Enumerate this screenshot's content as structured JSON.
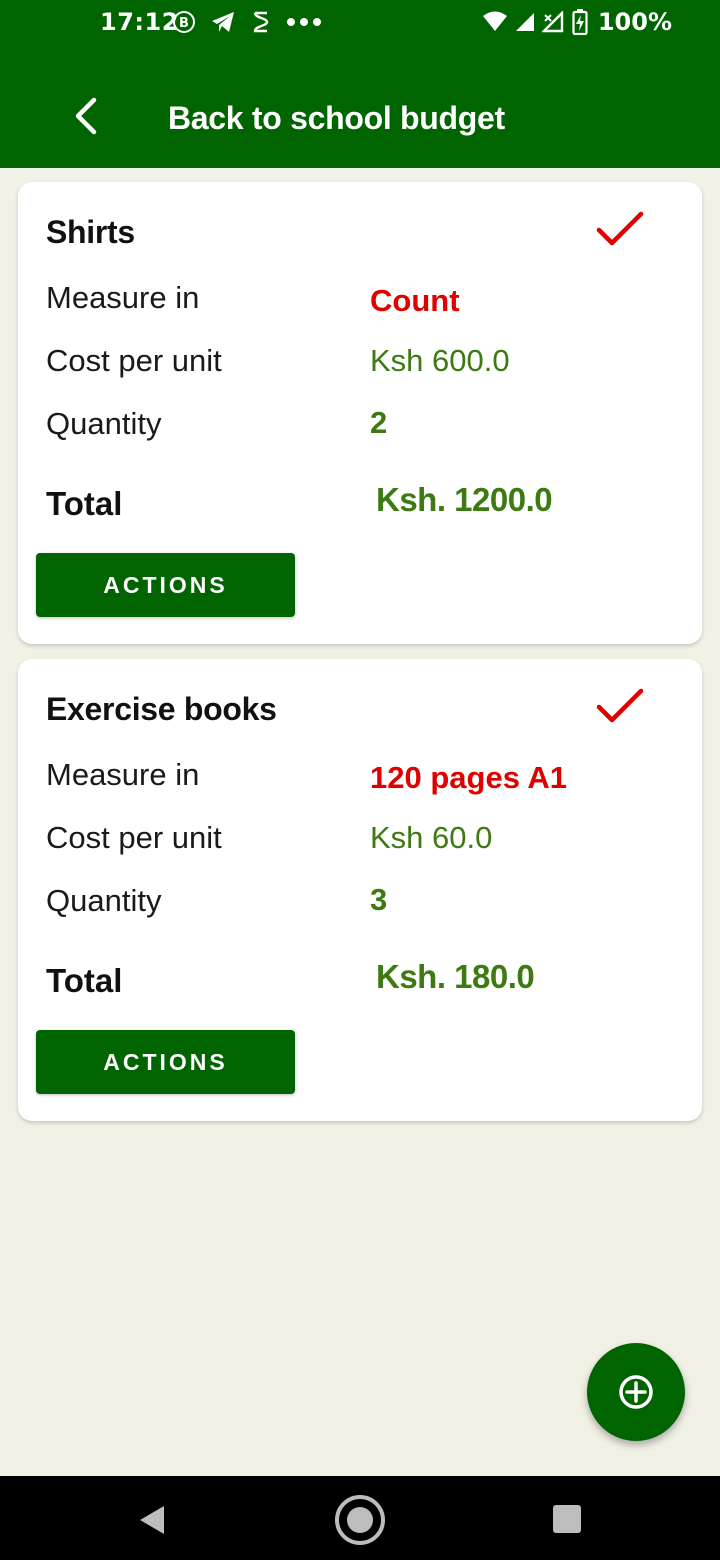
{
  "status_bar": {
    "time": "17:12",
    "battery": "100%",
    "icons_left": [
      "b-circle-icon",
      "telegram-icon",
      "sim-icon",
      "more-dots-icon"
    ],
    "icons_right": [
      "wifi-icon",
      "signal-icon",
      "signal-x-icon",
      "battery-charging-icon"
    ]
  },
  "app_bar": {
    "title": "Back to school budget",
    "back_icon": "chevron-left-icon"
  },
  "items": [
    {
      "name": "Shirts",
      "measure_label": "Measure in",
      "measure_value": "Count",
      "cost_label": "Cost per unit",
      "cost_value": "Ksh 600.0",
      "quantity_label": "Quantity",
      "quantity_value": "2",
      "total_label": "Total",
      "total_value": "Ksh. 1200.0",
      "actions_label": "ACTIONS",
      "checked": true
    },
    {
      "name": "Exercise books",
      "measure_label": "Measure in",
      "measure_value": "120 pages A1",
      "cost_label": "Cost per unit",
      "cost_value": "Ksh 60.0",
      "quantity_label": "Quantity",
      "quantity_value": "3",
      "total_label": "Total",
      "total_value": "Ksh. 180.0",
      "actions_label": "ACTIONS",
      "checked": true
    }
  ],
  "fab": {
    "icon": "add-circle-icon"
  },
  "colors": {
    "primary": "#006400",
    "accent_red": "#e00000",
    "value_green": "#3d7a12",
    "background": "#f2f1e6"
  }
}
